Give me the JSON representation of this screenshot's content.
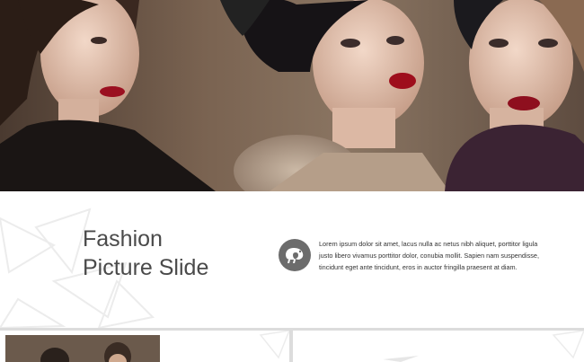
{
  "slide": {
    "title_line1": "Fashion",
    "title_line2": "Picture Slide",
    "icon": "chameleon-icon",
    "body": "Lorem ipsum dolor sit amet, lacus nulla ac netus nibh aliquet, porttitor ligula justo libero vivamus porttitor dolor, conubia mollit. Sapien nam suspendisse, tincidunt eget ante tincidunt, eros in auctor fringilla praesent at diam.",
    "photo": "three-women-fashion-photo"
  },
  "colors": {
    "title": "#4a4a4a",
    "icon_bg": "#6c6c6c",
    "page_bg": "#dcdcdc"
  },
  "thumbnails": [
    {
      "name": "next-slide-thumbnail-1",
      "photo": "two-men-fashion-photo"
    },
    {
      "name": "next-slide-thumbnail-2"
    }
  ]
}
